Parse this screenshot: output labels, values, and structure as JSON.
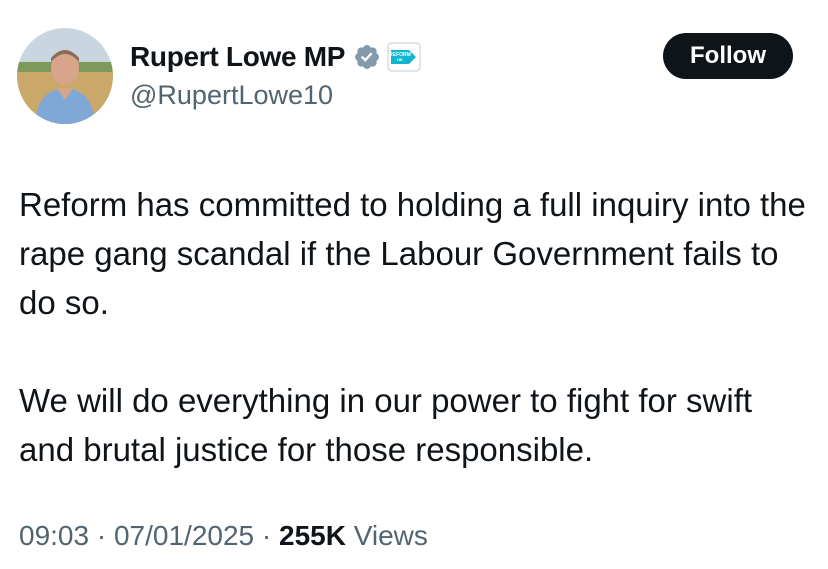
{
  "author": {
    "display_name": "Rupert Lowe MP",
    "handle": "@RupertLowe10",
    "verified_badge_icon": "verified-badge-icon",
    "affiliate_badge_icon": "reform-uk-affiliate-icon",
    "affiliate_badge_text": "REFORM UK",
    "avatar": "avatar-photo"
  },
  "actions": {
    "follow_label": "Follow"
  },
  "tweet": {
    "paragraphs": [
      "Reform has committed to holding a full inquiry into the rape gang scandal if the Labour Government fails to do so.",
      "We will do everything in our power to fight for swift and brutal justice for those responsible."
    ]
  },
  "meta": {
    "time": "09:03",
    "separator": "·",
    "date": "07/01/2025",
    "views_count": "255K",
    "views_label": "Views"
  },
  "colors": {
    "text_primary": "#0f1419",
    "text_secondary": "#536471",
    "verified_badge": "#829aab",
    "affiliate_badge": "#12b6cf",
    "follow_button_bg": "#0f1419"
  }
}
